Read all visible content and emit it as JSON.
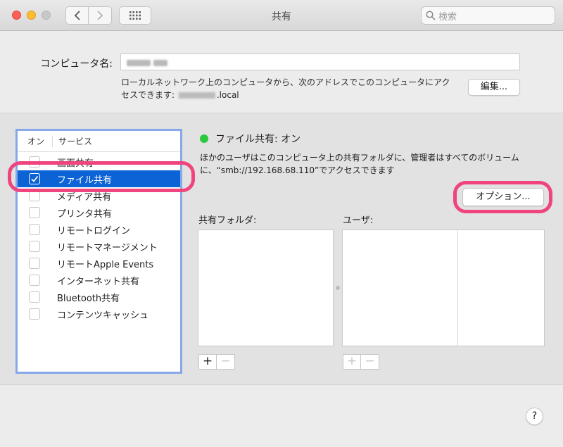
{
  "window": {
    "title": "共有"
  },
  "search": {
    "placeholder": "検索"
  },
  "computer_name": {
    "label": "コンピュータ名:",
    "address_line1": "ローカルネットワーク上のコンピュータから、次のアドレスでこのコンピュータにアク",
    "address_prefix": "セスできます: ",
    "address_suffix": ".local",
    "edit_label": "編集..."
  },
  "service_list": {
    "header_on": "オン",
    "header_service": "サービス",
    "items": [
      {
        "label": "画面共有",
        "checked": false
      },
      {
        "label": "ファイル共有",
        "checked": true,
        "selected": true
      },
      {
        "label": "メディア共有",
        "checked": false
      },
      {
        "label": "プリンタ共有",
        "checked": false
      },
      {
        "label": "リモートログイン",
        "checked": false
      },
      {
        "label": "リモートマネージメント",
        "checked": false
      },
      {
        "label": "リモートApple Events",
        "checked": false
      },
      {
        "label": "インターネット共有",
        "checked": false
      },
      {
        "label": "Bluetooth共有",
        "checked": false
      },
      {
        "label": "コンテンツキャッシュ",
        "checked": false
      }
    ]
  },
  "detail": {
    "status": "ファイル共有: オン",
    "status_color": "#2bc840",
    "description": "ほかのユーザはこのコンピュータ上の共有フォルダに、管理者はすべてのボリューム に、“smb://192.168.68.110”でアクセスできます",
    "options_label": "オプション...",
    "shared_folders_label": "共有フォルダ:",
    "users_label": "ユーザ:",
    "add_label": "+",
    "remove_label": "−"
  },
  "help_label": "?",
  "colors": {
    "selection": "#0b63d6",
    "highlight": "#f0447d",
    "list_border": "#86a8e8"
  }
}
